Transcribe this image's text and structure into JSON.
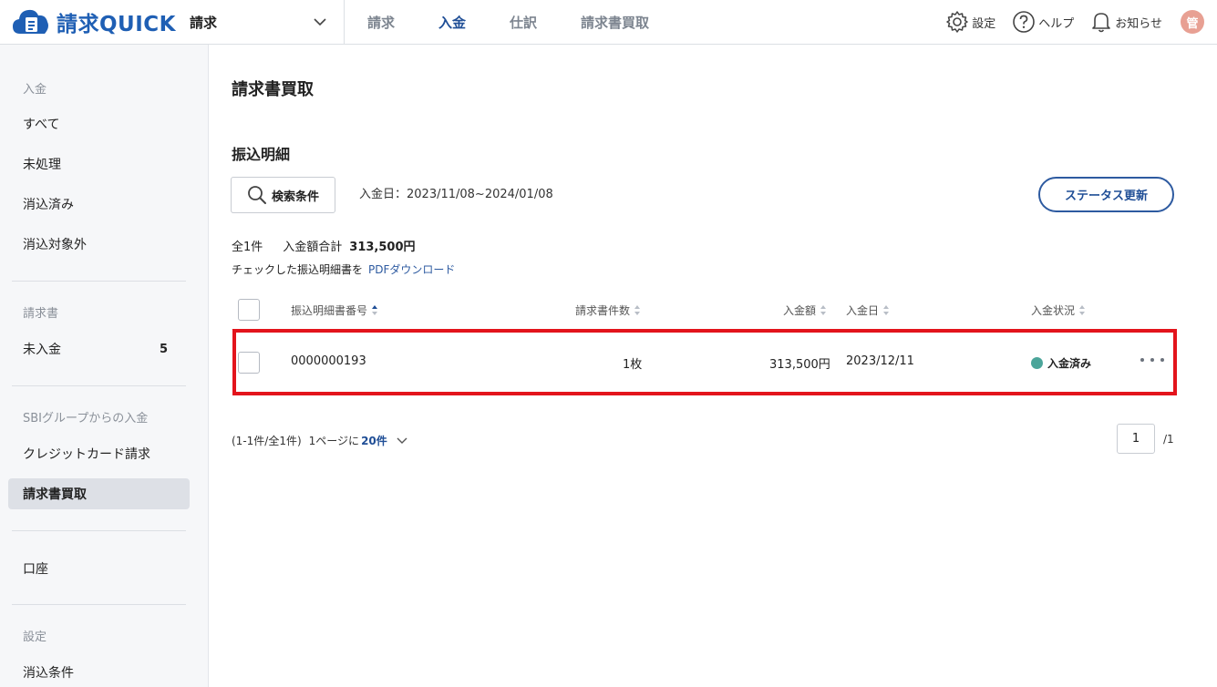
{
  "header": {
    "logo_text": "請求QUICK",
    "service_select": "請求",
    "nav": [
      "請求",
      "入金",
      "仕訳",
      "請求書買取"
    ],
    "nav_active": "入金",
    "settings": "設定",
    "help": "ヘルプ",
    "notifications": "お知らせ",
    "avatar": "管"
  },
  "sidebar": {
    "section_payment": "入金",
    "all": "すべて",
    "unprocessed": "未処理",
    "reconciled": "消込済み",
    "excluded": "消込対象外",
    "section_invoice": "請求書",
    "unpaid": "未入金",
    "unpaid_count": "5",
    "section_sbi": "SBIグループからの入金",
    "credit_card": "クレジットカード請求",
    "factoring": "請求書買取",
    "account": "口座",
    "section_settings": "設定",
    "reconcile_rules": "消込条件"
  },
  "main": {
    "page_title": "請求書買取",
    "section_title": "振込明細",
    "search_button": "検索条件",
    "date_range": "入金日：2023/11/08~2024/01/08",
    "status_update_button": "ステータス更新",
    "summary_count": "全1件",
    "summary_total_label": "入金額合計",
    "summary_total_value": "313,500円",
    "pdf_prefix": "チェックした振込明細書を",
    "pdf_link": "PDFダウンロード",
    "columns": {
      "number": "振込明細書番号",
      "invoice_count": "請求書件数",
      "amount": "入金額",
      "date": "入金日",
      "status": "入金状況"
    },
    "rows": [
      {
        "number": "0000000193",
        "invoice_count": "1枚",
        "amount": "313,500円",
        "date": "2023/12/11",
        "status": "入金済み"
      }
    ],
    "pager_range": "(1-1件/全1件)",
    "per_page_label": "1ページに",
    "per_page_value": "20件",
    "current_page": "1",
    "total_pages": "/1"
  },
  "colors": {
    "brand": "#1f5fb4",
    "accent": "#1f4e96",
    "highlight": "#e3141c",
    "status_paid": "#4ba59a"
  }
}
